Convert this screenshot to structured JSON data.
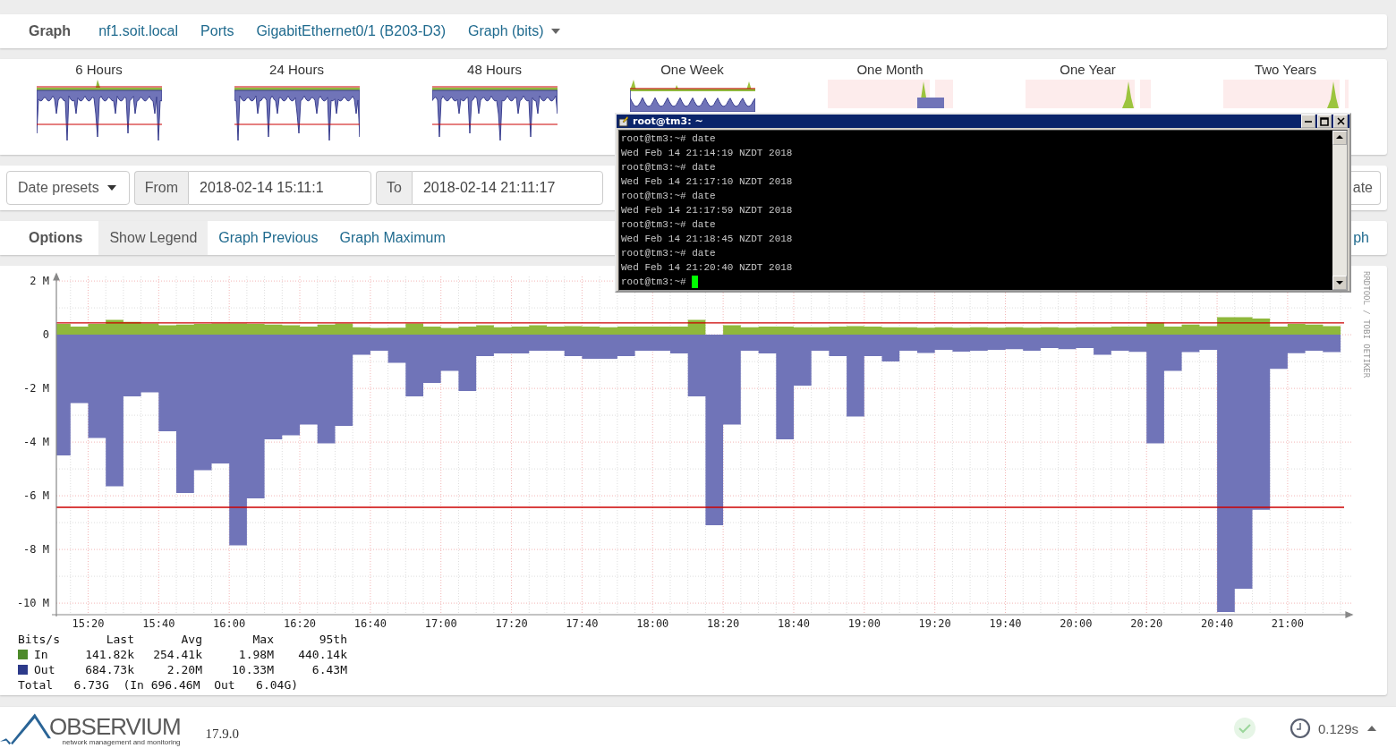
{
  "breadcrumb": {
    "title": "Graph",
    "items": [
      {
        "label": "nf1.soit.local",
        "dropdown": false
      },
      {
        "label": "Ports",
        "dropdown": false
      },
      {
        "label": "GigabitEthernet0/1 (B203-D3)",
        "dropdown": false
      },
      {
        "label": "Graph (bits)",
        "dropdown": true
      }
    ]
  },
  "thumbnails": [
    {
      "label": "6 Hours",
      "kind": "traffic"
    },
    {
      "label": "24 Hours",
      "kind": "traffic"
    },
    {
      "label": "48 Hours",
      "kind": "traffic"
    },
    {
      "label": "One Week",
      "kind": "partial"
    },
    {
      "label": "One Month",
      "kind": "sparse"
    },
    {
      "label": "One Year",
      "kind": "sparse"
    },
    {
      "label": "Two Years",
      "kind": "sparse"
    }
  ],
  "date_range": {
    "presets": "Date presets",
    "from_label": "From",
    "from_value": "2018-02-14 15:11:1",
    "to_label": "To",
    "to_value": "2018-02-14 21:11:17",
    "action": "ate"
  },
  "options": {
    "title": "Options",
    "items": [
      {
        "label": "Show Legend",
        "selected": true
      },
      {
        "label": "Graph Previous",
        "selected": false
      },
      {
        "label": "Graph Maximum",
        "selected": false
      }
    ],
    "more": "ph"
  },
  "graph": {
    "chart_data": {
      "type": "area",
      "x": [
        911,
        915,
        920,
        925,
        930,
        935,
        940,
        945,
        950,
        955,
        960,
        965,
        970,
        975,
        980,
        985,
        990,
        995,
        1000,
        1005,
        1010,
        1015,
        1020,
        1025,
        1030,
        1035,
        1040,
        1045,
        1050,
        1055,
        1060,
        1065,
        1070,
        1075,
        1080,
        1085,
        1090,
        1095,
        1100,
        1105,
        1110,
        1115,
        1120,
        1125,
        1130,
        1135,
        1140,
        1145,
        1150,
        1155,
        1160,
        1165,
        1170,
        1175,
        1180,
        1185,
        1190,
        1195,
        1200,
        1205,
        1210,
        1215,
        1220,
        1225,
        1230,
        1235,
        1240,
        1245,
        1250,
        1255,
        1260,
        1265,
        1270,
        1275
      ],
      "series": [
        {
          "name": "In",
          "color": "#8fb83c",
          "values": [
            0.4,
            0.4,
            0.3,
            0.4,
            0.55,
            0.48,
            0.42,
            0.35,
            0.38,
            0.4,
            0.42,
            0.42,
            0.4,
            0.38,
            0.35,
            0.3,
            0.38,
            0.42,
            0.28,
            0.25,
            0.26,
            0.42,
            0.3,
            0.25,
            0.3,
            0.35,
            0.28,
            0.3,
            0.35,
            0.3,
            0.32,
            0.3,
            0.28,
            0.3,
            0.3,
            0.3,
            0.3,
            0.55,
            null,
            0.35,
            0.28,
            0.3,
            0.3,
            0.28,
            0.28,
            0.3,
            0.32,
            0.3,
            0.28,
            0.28,
            0.26,
            0.28,
            0.26,
            0.28,
            0.26,
            0.28,
            0.26,
            0.28,
            0.26,
            0.28,
            0.28,
            0.3,
            0.3,
            0.45,
            0.3,
            0.38,
            0.32,
            0.65,
            0.65,
            0.6,
            0.3,
            0.4,
            0.38,
            0.32
          ]
        },
        {
          "name": "Out",
          "color": "#7074b8",
          "values": [
            -4.5,
            -4.5,
            -2.55,
            -3.85,
            -5.65,
            -2.3,
            -2.15,
            -3.6,
            -5.9,
            -5.05,
            -4.8,
            -7.85,
            -6.1,
            -3.9,
            -3.75,
            -3.35,
            -4.05,
            -3.4,
            -0.75,
            -0.6,
            -1.05,
            -2.3,
            -1.8,
            -1.35,
            -2.1,
            -0.8,
            -0.7,
            -0.7,
            -0.6,
            -0.6,
            -0.8,
            -0.9,
            -0.9,
            -0.8,
            -0.6,
            -0.6,
            -0.7,
            -2.3,
            -7.1,
            -3.35,
            -0.6,
            -0.7,
            -3.9,
            -1.9,
            -0.6,
            -0.8,
            -3.05,
            -0.8,
            -1.0,
            -0.6,
            -0.68,
            -0.56,
            -0.63,
            -0.6,
            -0.56,
            -0.54,
            -0.6,
            -0.5,
            -0.54,
            -0.5,
            -0.75,
            -0.6,
            -0.64,
            -4.05,
            -1.35,
            -0.65,
            -0.56,
            -10.33,
            -9.46,
            -6.52,
            -1.27,
            -0.69,
            -0.6,
            -0.65
          ]
        }
      ],
      "xlim": [
        911,
        1276
      ],
      "ylim": [
        -10.43,
        2.17
      ],
      "xticks": [
        {
          "value": 920,
          "label": "15:20"
        },
        {
          "value": 940,
          "label": "15:40"
        },
        {
          "value": 960,
          "label": "16:00"
        },
        {
          "value": 980,
          "label": "16:20"
        },
        {
          "value": 1000,
          "label": "16:40"
        },
        {
          "value": 1020,
          "label": "17:00"
        },
        {
          "value": 1040,
          "label": "17:20"
        },
        {
          "value": 1060,
          "label": "17:40"
        },
        {
          "value": 1080,
          "label": "18:00"
        },
        {
          "value": 1100,
          "label": "18:20"
        },
        {
          "value": 1120,
          "label": "18:40"
        },
        {
          "value": 1140,
          "label": "19:00"
        },
        {
          "value": 1160,
          "label": "19:20"
        },
        {
          "value": 1180,
          "label": "19:40"
        },
        {
          "value": 1200,
          "label": "20:00"
        },
        {
          "value": 1220,
          "label": "20:20"
        },
        {
          "value": 1240,
          "label": "20:40"
        },
        {
          "value": 1260,
          "label": "21:00"
        }
      ],
      "yticks": [
        {
          "value": 2,
          "label": "2 M"
        },
        {
          "value": 0,
          "label": "0"
        },
        {
          "value": -2,
          "label": "-2 M"
        },
        {
          "value": -4,
          "label": "-4 M"
        },
        {
          "value": -6,
          "label": "-6 M"
        },
        {
          "value": -8,
          "label": "-8 M"
        },
        {
          "value": -10,
          "label": "-10 M"
        }
      ],
      "grid": true,
      "ref_lines": [
        {
          "axis": "y",
          "value": 0.44,
          "color": "#cc0000"
        },
        {
          "axis": "y",
          "value": -6.43,
          "color": "#cc0000"
        }
      ]
    },
    "credit": "RRDTOOL / TOBI OETIKER",
    "legend": {
      "columns": [
        "Bits/s",
        "Last",
        "Avg",
        "Max",
        "95th"
      ],
      "rows": [
        {
          "color": "#4d8a2a",
          "values": [
            "141.82k",
            "254.41k",
            "1.98M",
            "440.14k"
          ]
        },
        {
          "color": "#2c3a8a",
          "values": [
            "684.73k",
            "2.20M",
            "10.33M",
            "6.43M"
          ]
        }
      ],
      "total": "Total   6.73G  (In 696.46M  Out   6.04G)"
    }
  },
  "terminal": {
    "title": "root@tm3: ~",
    "lines": [
      "root@tm3:~# date",
      "Wed Feb 14 21:14:19 NZDT 2018",
      "root@tm3:~# date",
      "Wed Feb 14 21:17:10 NZDT 2018",
      "root@tm3:~# date",
      "Wed Feb 14 21:17:59 NZDT 2018",
      "root@tm3:~# date",
      "Wed Feb 14 21:18:45 NZDT 2018",
      "root@tm3:~# date",
      "Wed Feb 14 21:20:40 NZDT 2018",
      "root@tm3:~#"
    ],
    "cursor": true
  },
  "footer": {
    "brand": "OBSERVIUM",
    "tagline": "network management and monitoring",
    "version": "17.9.0",
    "timing": "0.129s"
  }
}
